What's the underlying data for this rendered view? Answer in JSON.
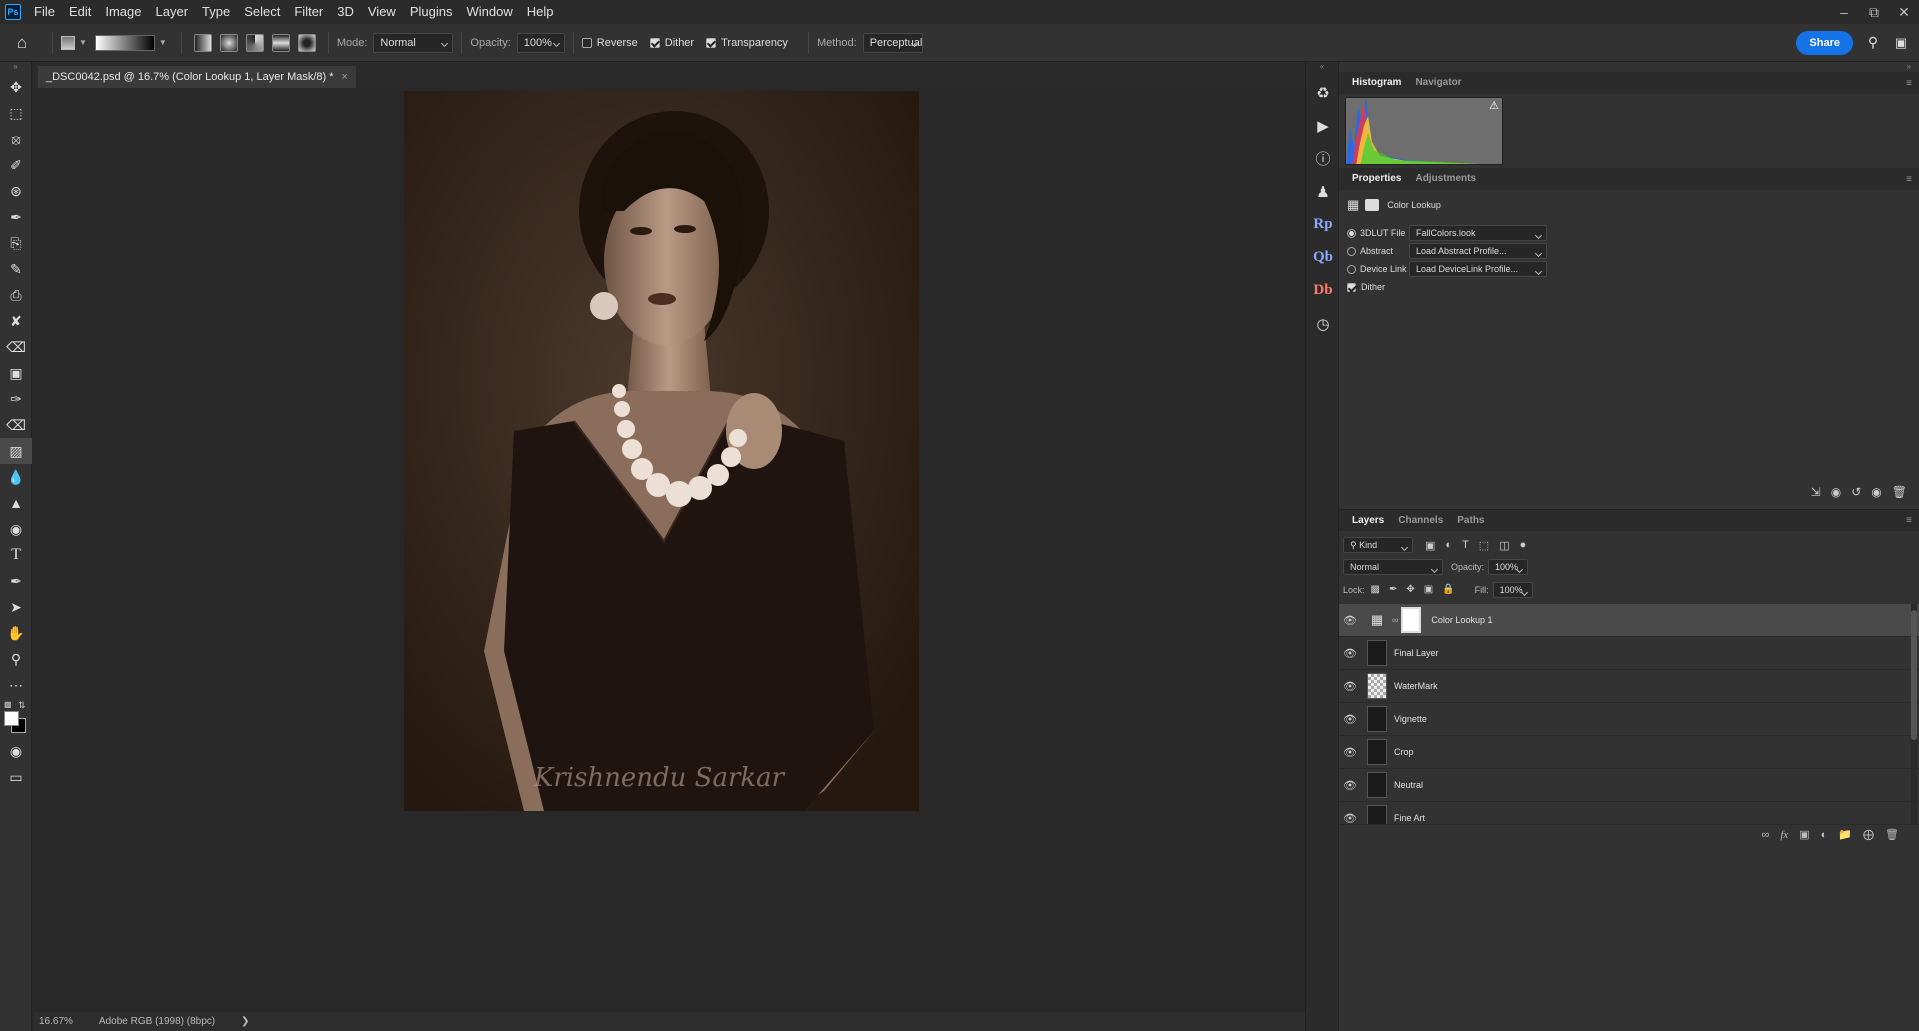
{
  "menubar": {
    "logo": "Ps",
    "items": [
      "File",
      "Edit",
      "Image",
      "Layer",
      "Type",
      "Select",
      "Filter",
      "3D",
      "View",
      "Plugins",
      "Window",
      "Help"
    ]
  },
  "options": {
    "mode_label": "Mode:",
    "mode_value": "Normal",
    "opacity_label": "Opacity:",
    "opacity_value": "100%",
    "reverse_label": "Reverse",
    "dither_label": "Dither",
    "transparency_label": "Transparency",
    "method_label": "Method:",
    "method_value": "Perceptual",
    "share_label": "Share"
  },
  "document": {
    "tab_title": "_DSC0042.psd @ 16.7% (Color Lookup 1, Layer Mask/8) *",
    "zoom": "16.67%",
    "color_profile": "Adobe RGB (1998) (8bpc)",
    "watermark_text": "Krishnendu Sarkar"
  },
  "histogram_panel": {
    "tabs": [
      "Histogram",
      "Navigator"
    ]
  },
  "properties_panel": {
    "tabs": [
      "Properties",
      "Adjustments"
    ],
    "title": "Color Lookup",
    "rows": [
      {
        "label": "3DLUT File",
        "value": "FallColors.look",
        "selected": true
      },
      {
        "label": "Abstract",
        "value": "Load Abstract Profile...",
        "selected": false
      },
      {
        "label": "Device Link",
        "value": "Load DeviceLink Profile...",
        "selected": false
      }
    ],
    "dither_label": "Dither"
  },
  "layers_panel": {
    "tabs": [
      "Layers",
      "Channels",
      "Paths"
    ],
    "filter_kind": "Kind",
    "blend_mode": "Normal",
    "opacity_label": "Opacity:",
    "opacity_value": "100%",
    "lock_label": "Lock:",
    "fill_label": "Fill:",
    "fill_value": "100%",
    "layers": [
      {
        "name": "Color Lookup 1"
      },
      {
        "name": "Final Layer"
      },
      {
        "name": "WaterMark"
      },
      {
        "name": "Vignette"
      },
      {
        "name": "Crop"
      },
      {
        "name": "Neutral"
      },
      {
        "name": "Fine Art"
      }
    ]
  },
  "colors": {
    "accent": "#1473e6",
    "panel_bg": "#323232",
    "canvas_bg": "#282828"
  }
}
